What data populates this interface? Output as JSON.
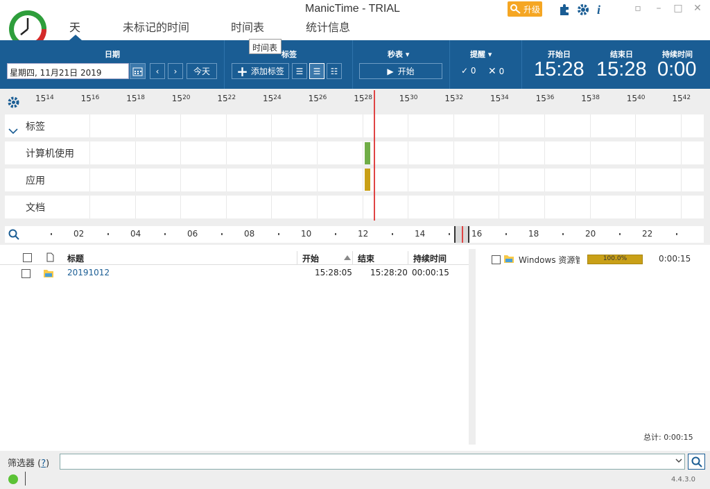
{
  "window": {
    "title": "ManicTime - TRIAL",
    "upgrade_label": "升级",
    "icons": [
      "key-icon",
      "puzzle-icon",
      "gear-icon",
      "info-icon"
    ]
  },
  "tabs": [
    {
      "label": "天"
    },
    {
      "label": "未标记的时间"
    },
    {
      "label": "时间表"
    },
    {
      "label": "统计信息"
    }
  ],
  "tooltip": "时间表",
  "ribbon": {
    "date_label": "日期",
    "date_value": "星期四, 11月21日 2019",
    "today_label": "今天",
    "tags_label": "标签",
    "add_tag_label": "添加标签",
    "stopwatch_label": "秒表",
    "start_label": "开始",
    "reminder_label": "提醒",
    "reminder_ok": "0",
    "reminder_x": "0",
    "start_day_label": "开始日",
    "end_day_label": "结束日",
    "duration_label": "持续时间",
    "start_time": "15:28",
    "end_time": "15:28",
    "duration": "0:00"
  },
  "timeline": {
    "ticks": [
      [
        "15",
        "14"
      ],
      [
        "15",
        "16"
      ],
      [
        "15",
        "18"
      ],
      [
        "15",
        "20"
      ],
      [
        "15",
        "22"
      ],
      [
        "15",
        "24"
      ],
      [
        "15",
        "26"
      ],
      [
        "15",
        "28"
      ],
      [
        "15",
        "30"
      ],
      [
        "15",
        "32"
      ],
      [
        "15",
        "34"
      ],
      [
        "15",
        "36"
      ],
      [
        "15",
        "38"
      ],
      [
        "15",
        "40"
      ],
      [
        "15",
        "42"
      ]
    ],
    "tracks": [
      {
        "label": "标签"
      },
      {
        "label": "计算机使用"
      },
      {
        "label": "应用"
      },
      {
        "label": "文档"
      }
    ],
    "overview_ticks": [
      "02",
      "04",
      "06",
      "08",
      "10",
      "12",
      "14",
      "16",
      "18",
      "20",
      "22"
    ],
    "colors": {
      "computer_use": "#70ad47",
      "application": "#c9a017",
      "now": "#e04444"
    }
  },
  "table": {
    "headers": {
      "title": "标题",
      "start": "开始",
      "end": "结束",
      "duration": "持续时间"
    },
    "rows": [
      {
        "title": "20191012",
        "start": "15:28:05",
        "end": "15:28:20",
        "duration": "00:00:15"
      }
    ]
  },
  "apps": {
    "rows": [
      {
        "name": "Windows 资源管",
        "percent": "100.0%",
        "duration": "0:00:15"
      }
    ],
    "total": "总计: 0:00:15"
  },
  "filter": {
    "label": "筛选器",
    "help": "?"
  },
  "status": {
    "version": "4.4.3.0"
  }
}
